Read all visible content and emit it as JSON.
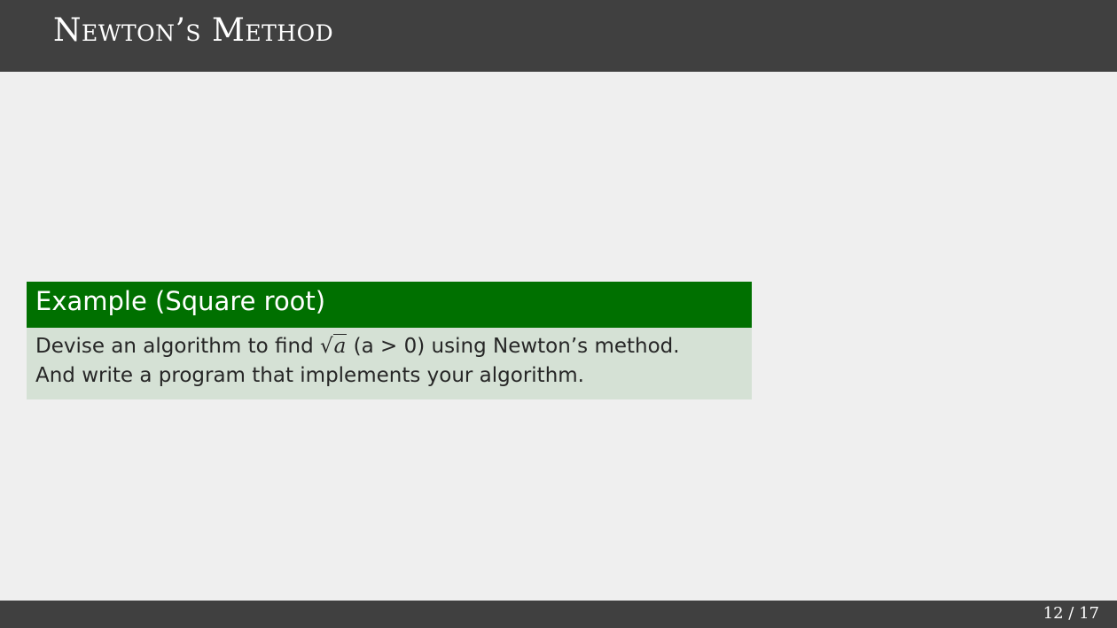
{
  "slide": {
    "title": "Newton’s Method"
  },
  "example": {
    "header": "Example (Square root)",
    "line1_prefix": "Devise an algorithm to find ",
    "sqrt_symbol": "√",
    "sqrt_arg": "a",
    "condition": " (a > 0)",
    "line1_suffix": " using Newton’s method.",
    "line2": "And write a program that implements your algorithm."
  },
  "footer": {
    "page_number": "12 / 17"
  }
}
